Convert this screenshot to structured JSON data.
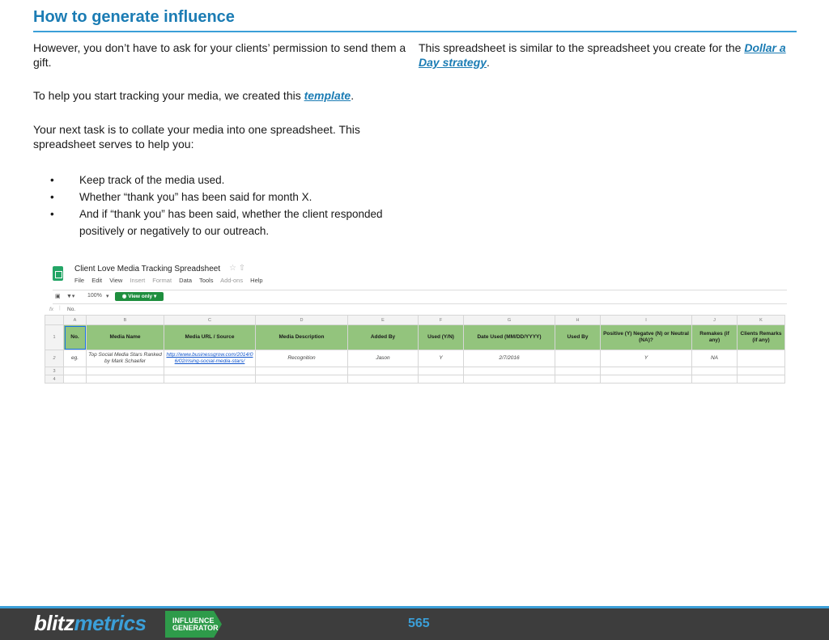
{
  "title": "How to generate influence",
  "col_left": {
    "para1": "However, you don’t have to ask for your clients’ permission to send them a gift.",
    "para2_prefix": "To help you start tracking your media, we created this ",
    "para2_link": "template",
    "para2_suffix": ".",
    "para3": "Your next task is to collate your media into one spreadsheet. This spreadsheet serves to help you:",
    "bullets": [
      "Keep track of the media used.",
      "Whether “thank you” has been said for month X.",
      "And if “thank you” has been said, whether the client responded positively or negatively to our outreach."
    ]
  },
  "col_right": {
    "text": "This spreadsheet is similar to the spreadsheet you create for the ",
    "link": "Dollar a Day strategy",
    "suffix": "."
  },
  "sheet": {
    "title": "Client Love Media Tracking Spreadsheet",
    "menu": [
      "File",
      "Edit",
      "View",
      "Insert",
      "Format",
      "Data",
      "Tools",
      "Add-ons",
      "Help"
    ],
    "zoom": "100%",
    "view_only": "View only",
    "fx_label": "fx",
    "fx_value": "No.",
    "column_letters": [
      "A",
      "B",
      "C",
      "D",
      "E",
      "F",
      "G",
      "H",
      "I",
      "J",
      "K"
    ],
    "row_numbers": [
      "1",
      "2",
      "3",
      "4"
    ],
    "headers": [
      "No.",
      "Media Name",
      "Media URL / Source",
      "Media Description",
      "Added By",
      "Used (Y/N)",
      "Date Used (MM/DD/YYYY)",
      "Used By",
      "Positive (Y) Negatve (N) or Neutral (NA)?",
      "Remakes (if any)",
      "Clients Remarks (if any)"
    ],
    "row": [
      "eg.",
      "Top Social Media Stars Ranked by Mark Schaefer",
      "http://www.businessgrow.com/2014/06/02/rising-social-media-stars/",
      "Recognition",
      "Jason",
      "Y",
      "2/7/2016",
      "",
      "Y",
      "NA",
      ""
    ]
  },
  "footer": {
    "brand_part1": "blitz",
    "brand_part2": "metrics",
    "badge_line1": "INFLUENCE",
    "badge_line2": "GENERATOR",
    "page_number": "565"
  }
}
